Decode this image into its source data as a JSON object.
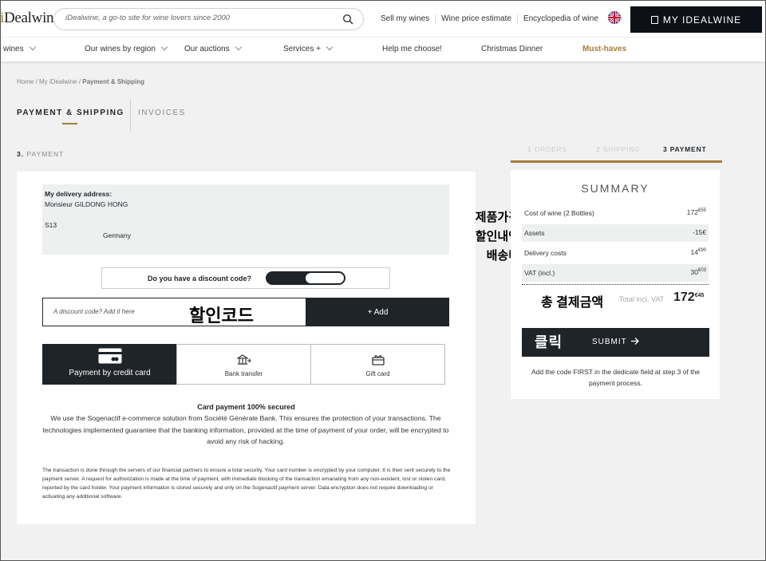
{
  "header": {
    "logo_prefix": "iD",
    "logo_main": "ealwine",
    "search_placeholder": "iDealwine, a go-to site for wine lovers since 2000",
    "top_links": [
      "Sell my wines",
      "Wine price estimate",
      "Encyclopedia of wine"
    ],
    "account_label": "MY IDEALWINE"
  },
  "nav": {
    "items": [
      {
        "label": "wines",
        "chevron": true
      },
      {
        "label": "Our wines by region",
        "chevron": true
      },
      {
        "label": "Our auctions",
        "chevron": true
      },
      {
        "label": "Services +",
        "chevron": true
      },
      {
        "label": "Help me choose!",
        "chevron": false
      },
      {
        "label": "Christmas Dinner",
        "chevron": false
      },
      {
        "label": "Must-haves",
        "chevron": false
      }
    ]
  },
  "breadcrumb": {
    "home": "Home",
    "sep1": " / ",
    "account": "My iDealwine",
    "sep2": " / ",
    "current": "Payment & Shipping"
  },
  "tabs": {
    "active": "PAYMENT & SHIPPING",
    "other": "INVOICES"
  },
  "step": {
    "number": "3.",
    "label": " PAYMENT"
  },
  "progress": {
    "step1": "1 ORDERS",
    "step2": "2 SHIPPING",
    "step3": "3 PAYMENT"
  },
  "address": {
    "label": "My delivery address:",
    "name": "Monsieur GILDONG HONG",
    "line": "S13",
    "country": "Germany"
  },
  "discount": {
    "question": "Do you have a discount code?",
    "input_placeholder": "A discount code? Add it here",
    "add_label": "+ Add",
    "annotation": "할인코드"
  },
  "methods": {
    "credit": "Payment by credit card",
    "bank": "Bank transfer",
    "gift": "Gift card"
  },
  "secure": {
    "title": "Card payment 100% secured",
    "body": "We use the Sogenactif e-commerce solution from Société Générale Bank. This ensures the protection of your transactions. The technologies implemented guarantee that the banking information, provided at the time of payment of your order, will be encrypted to avoid any risk of hacking.",
    "fine": "The transaction is done through the servers of our financial partners to ensure a total security. Your card number is encrypted by your computer. It is then sent securely to the payment server. A request for authorization is made at the time of payment, with immediate blocking of the transaction emanating from any non-existent, lost or stolen card, reported by the card holder. Your payment information is stored securely and only on the Sogenactif payment server. Data encryption does not require downloading or activating any additional software."
  },
  "summary": {
    "title": "SUMMARY",
    "rows": [
      {
        "label": "Cost of wine (2 Bottles)",
        "value": "172",
        "cents": "€55"
      },
      {
        "label": "Assets",
        "value": "-15€",
        "cents": ""
      },
      {
        "label": "Delivery costs",
        "value": "14",
        "cents": "€90"
      },
      {
        "label": "VAT (incl.)",
        "value": "30",
        "cents": "€03"
      }
    ],
    "total_label": "Total incl. VAT",
    "total_value": "172",
    "total_cents": "€45",
    "submit_label": "SUBMIT",
    "note": "Add the code FIRST in the dedicate field at step 3 of the payment process."
  },
  "annotations": {
    "product_price": "제품가격",
    "discount_detail": "할인내역",
    "shipping_fee": "배송비",
    "total_payment": "총 결제금액",
    "click": "클릭"
  },
  "colors": {
    "accent_gold": "#a47d3c",
    "dark": "#1f2429"
  }
}
